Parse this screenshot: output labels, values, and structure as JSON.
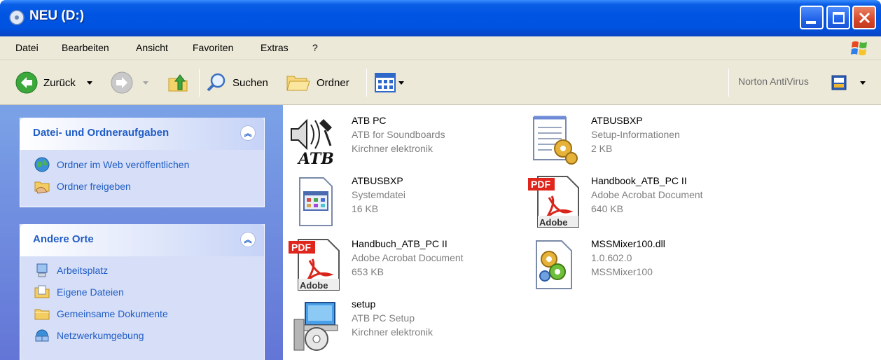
{
  "window": {
    "title": "NEU (D:)"
  },
  "menu": [
    "Datei",
    "Bearbeiten",
    "Ansicht",
    "Favoriten",
    "Extras",
    "?"
  ],
  "toolbar": {
    "back": "Zurück",
    "search": "Suchen",
    "folders": "Ordner",
    "norton": "Norton AntiVirus"
  },
  "tasks": {
    "title": "Datei- und Ordneraufgaben",
    "items": [
      "Ordner im Web veröffentlichen",
      "Ordner freigeben"
    ]
  },
  "places": {
    "title": "Andere Orte",
    "items": [
      "Arbeitsplatz",
      "Eigene Dateien",
      "Gemeinsame Dokumente",
      "Netzwerkumgebung"
    ]
  },
  "files": [
    {
      "name": "ATB PC",
      "line2": "ATB for Soundboards",
      "line3": "Kirchner elektronik",
      "icon": "atb-app-icon"
    },
    {
      "name": "ATBUSBXP",
      "line2": "Setup-Informationen",
      "line3": "2 KB",
      "icon": "setup-info-icon"
    },
    {
      "name": "ATBUSBXP",
      "line2": "Systemdatei",
      "line3": "16 KB",
      "icon": "system-file-icon"
    },
    {
      "name": "Handbook_ATB_PC II",
      "line2": "Adobe Acrobat Document",
      "line3": "640 KB",
      "icon": "pdf-icon"
    },
    {
      "name": "Handbuch_ATB_PC II",
      "line2": "Adobe Acrobat Document",
      "line3": "653 KB",
      "icon": "pdf-icon"
    },
    {
      "name": "MSSMixer100.dll",
      "line2": "1.0.602.0",
      "line3": "MSSMixer100",
      "icon": "dll-icon"
    },
    {
      "name": "setup",
      "line2": "ATB PC Setup",
      "line3": "Kirchner elektronik",
      "icon": "installer-icon"
    }
  ],
  "colors": {
    "titlebar": "#0054e3",
    "task_link": "#215dc6",
    "sidebar": "#7ba2e7",
    "chrome": "#ece9d8"
  }
}
